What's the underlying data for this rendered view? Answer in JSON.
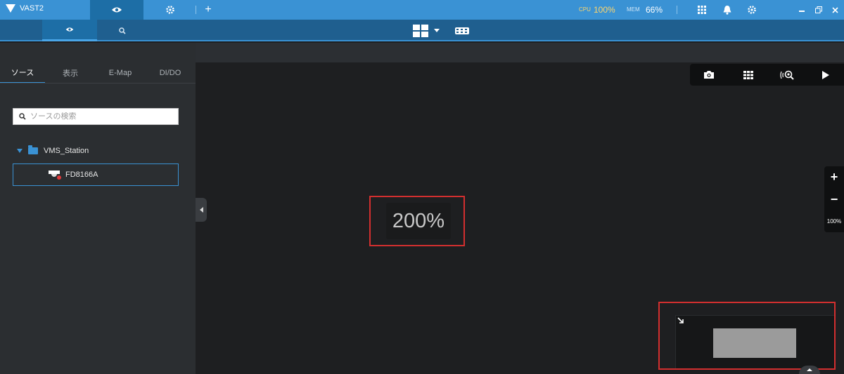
{
  "app": {
    "title": "VAST2"
  },
  "topbar": {
    "cpu_label": "CPU",
    "cpu_value": "100%",
    "mem_label": "MEM",
    "mem_value": "66%",
    "icons": [
      "eye-icon",
      "gear-icon",
      "plus-icon",
      "grid-apps-icon",
      "bell-icon",
      "settings-icon",
      "minimize-icon",
      "restore-icon",
      "close-icon"
    ]
  },
  "subbar": {
    "icons": [
      "eye-icon",
      "search-icon",
      "layout-2x2-icon",
      "dropdown-icon",
      "film-strip-icon"
    ]
  },
  "sidebar": {
    "tabs": [
      {
        "label": "ソース",
        "active": true
      },
      {
        "label": "表示",
        "active": false
      },
      {
        "label": "E-Map",
        "active": false
      },
      {
        "label": "DI/DO",
        "active": false
      }
    ],
    "search": {
      "placeholder": "ソースの検索",
      "value": ""
    },
    "tree": {
      "root_label": "VMS_Station",
      "items": [
        {
          "label": "FD8166A"
        }
      ]
    }
  },
  "viewer": {
    "toolbar_icons": [
      "camera-snapshot-icon",
      "grid-view-icon",
      "fisheye-search-icon",
      "play-icon"
    ],
    "zoom": {
      "plus": "+",
      "minus": "−",
      "level": "100%"
    },
    "zoom_indicator": "200%"
  },
  "colors": {
    "accent": "#3a92d4",
    "highlight_border": "#d32f2f",
    "cpu": "#ffd66b"
  }
}
